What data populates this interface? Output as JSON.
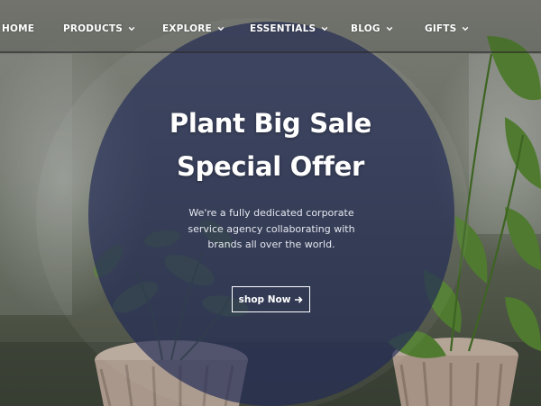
{
  "nav": {
    "items": [
      {
        "label": "HOME",
        "has_dropdown": false
      },
      {
        "label": "PRODUCTS",
        "has_dropdown": true
      },
      {
        "label": "EXPLORE",
        "has_dropdown": true
      },
      {
        "label": "ESSENTIALS",
        "has_dropdown": true
      },
      {
        "label": "BLOG",
        "has_dropdown": true
      },
      {
        "label": "GIFTS",
        "has_dropdown": true
      }
    ]
  },
  "hero": {
    "title_line1": "Plant Big Sale",
    "title_line2": "Special Offer",
    "subtitle_line1": "We're a fully dedicated corporate",
    "subtitle_line2": "service agency collaborating with",
    "subtitle_line3": "brands all over the world.",
    "cta_label": "shop Now",
    "cta_icon": "arrow-right-icon"
  },
  "colors": {
    "overlay": "#202a55",
    "text": "#ffffff"
  }
}
